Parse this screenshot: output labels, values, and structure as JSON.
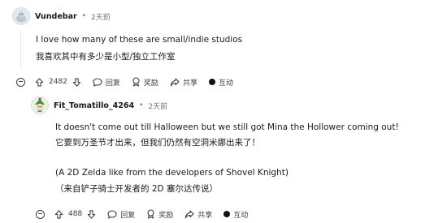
{
  "comment1": {
    "username": "Vundebar",
    "separator": "•",
    "time": "2天前",
    "text_en": "I love how many of these are small/indie studios",
    "text_zh": "我喜欢其中有多少是小型/独立工作室",
    "votes": "2482",
    "reply_label": "回复",
    "award_label": "奖励",
    "share_label": "共享",
    "interact_label": "互动"
  },
  "comment2": {
    "username": "Fit_Tomatillo_4264",
    "separator": "•",
    "time": "2天前",
    "text_en_1": "It doesn't come out till Halloween but we still got Mina the Hollower coming out!",
    "text_zh_1": "它要到万圣节才出来，但我们仍然有空洞米娜出来了！",
    "text_en_2": "(A 2D Zelda like from the developers of Shovel Knight)",
    "text_zh_2": "（来自铲子骑士开发者的 2D 塞尔达传说）",
    "votes": "488",
    "reply_label": "回复",
    "award_label": "奖励",
    "share_label": "共享",
    "interact_label": "互动"
  }
}
